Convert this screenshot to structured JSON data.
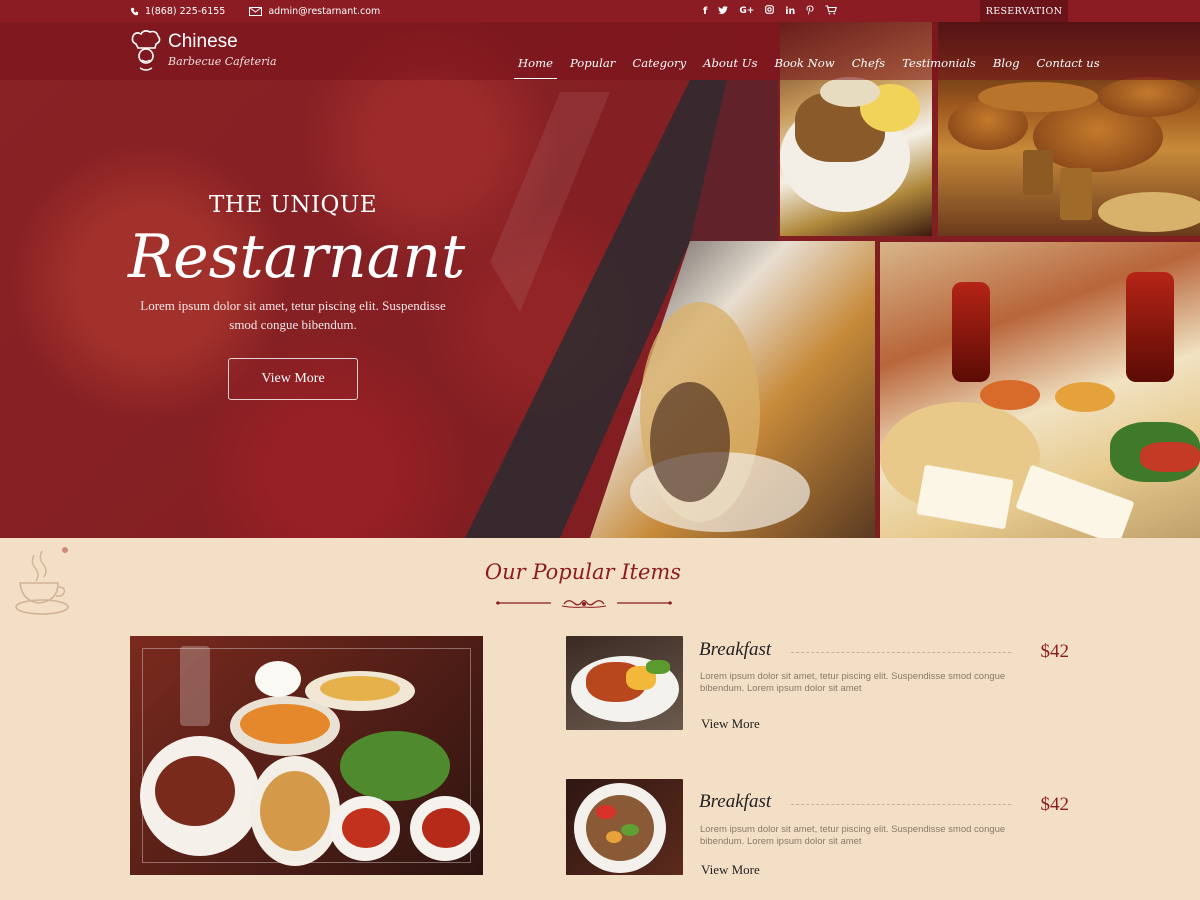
{
  "topbar": {
    "phone": "1(868) 225-6155",
    "email": "admin@restarnant.com",
    "socials": [
      "f",
      "t",
      "G+",
      "ig",
      "in",
      "p",
      "cart"
    ],
    "reservation": "RESERVATION"
  },
  "brand": {
    "name": "Chinese",
    "tagline": "Barbecue Cafeteria"
  },
  "nav": {
    "items": [
      "Home",
      "Popular",
      "Category",
      "About Us",
      "Book Now",
      "Chefs",
      "Testimonials",
      "Blog",
      "Contact us"
    ],
    "active": "Home"
  },
  "hero": {
    "kicker": "THE UNIQUE",
    "title": "Restarnant",
    "description": "Lorem ipsum dolor sit amet, tetur piscing elit. Suspendisse smod congue bibendum.",
    "button": "View More"
  },
  "popular": {
    "title": "Our Popular Items",
    "items": [
      {
        "name": "Breakfast",
        "price": "$42",
        "description": "Lorem ipsum dolor sit amet, tetur piscing elit. Suspendisse smod congue bibendum. Lorem ipsum dolor sit amet",
        "more": "View More"
      },
      {
        "name": "Breakfast",
        "price": "$42",
        "description": "Lorem ipsum dolor sit amet, tetur piscing elit. Suspendisse smod congue bibendum. Lorem ipsum dolor sit amet",
        "more": "View More"
      }
    ]
  },
  "colors": {
    "primary": "#8c1c24",
    "topbar": "#8c1c24",
    "section_bg": "#f3dfc5",
    "price": "#8c1c24"
  },
  "icons": {
    "phone": "phone-icon",
    "email": "envelope-icon",
    "logo": "chef-hat-icon",
    "decor": "coffee-cup-icon"
  }
}
